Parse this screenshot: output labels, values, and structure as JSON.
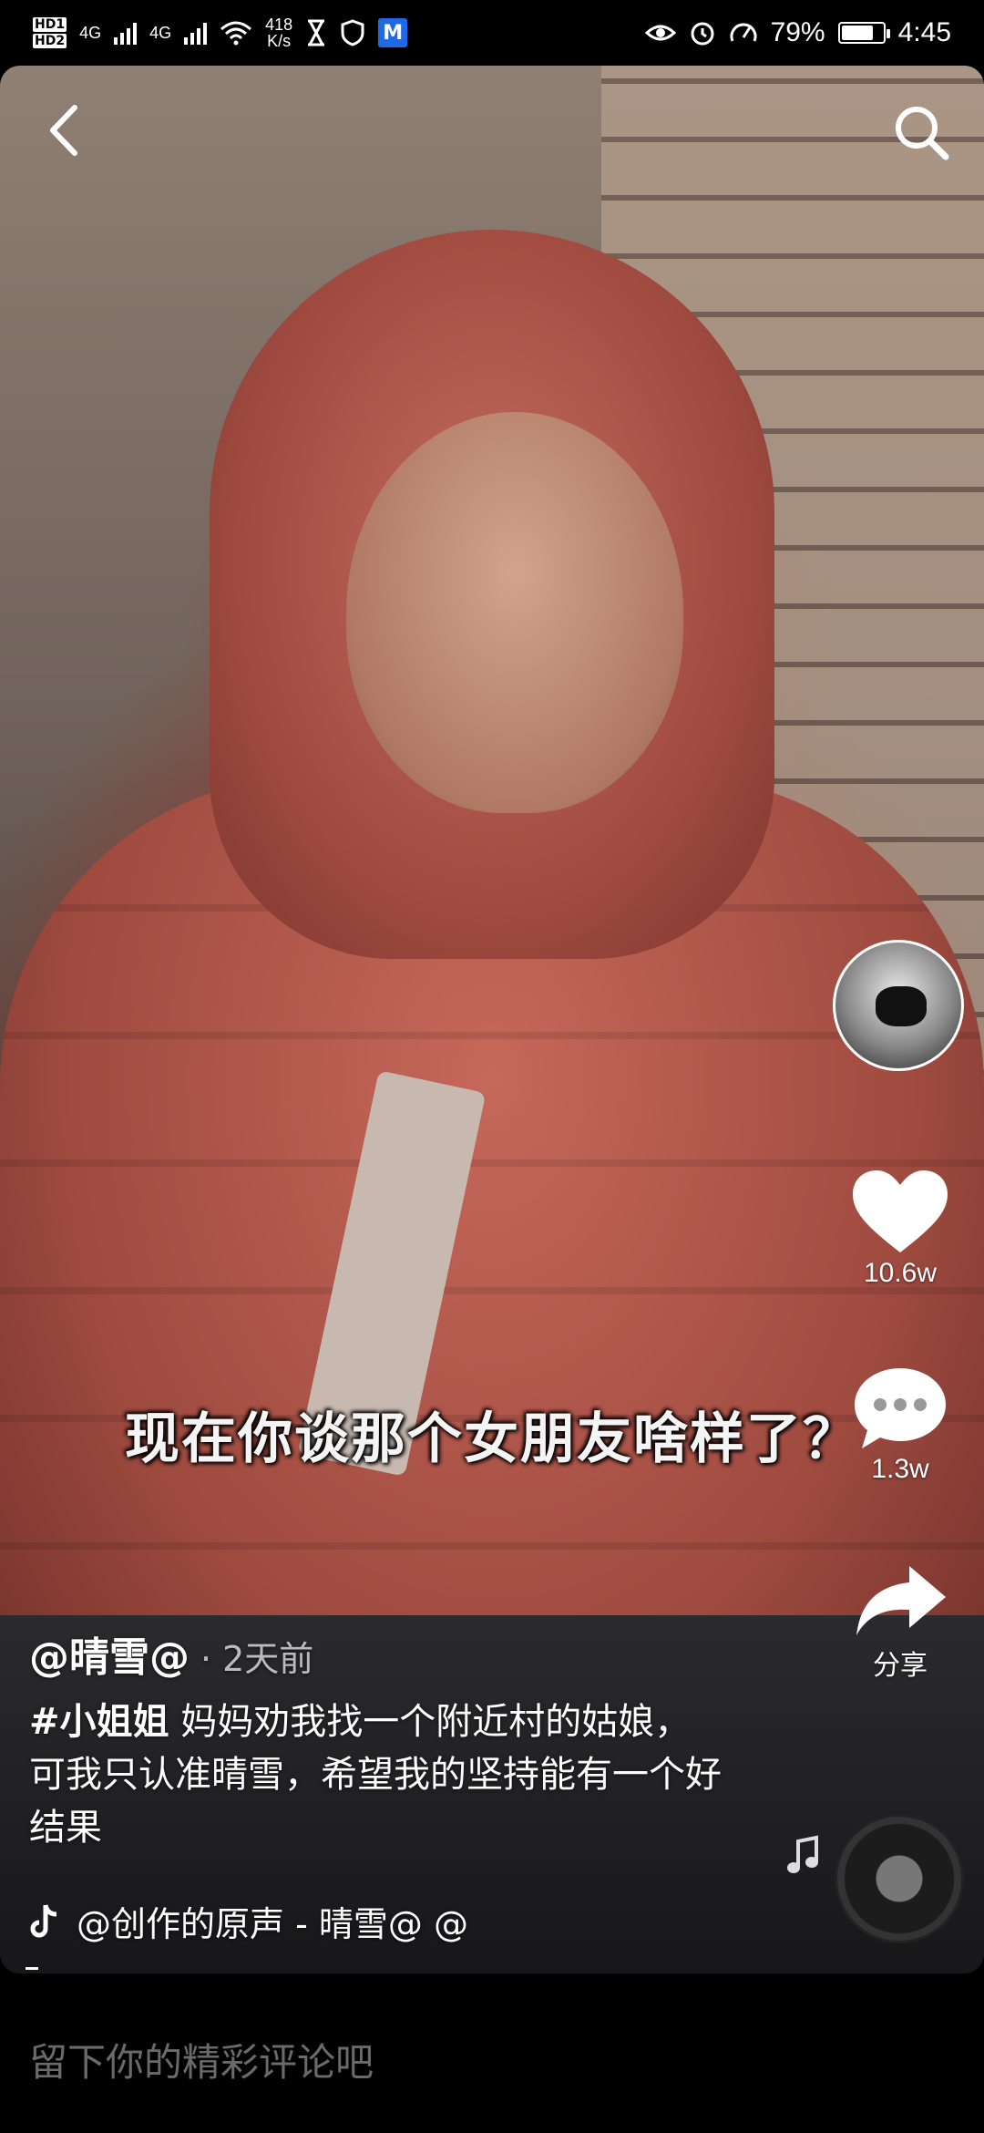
{
  "status_bar": {
    "hd1": "HD1",
    "hd2": "HD2",
    "net1": "4G",
    "net2": "4G",
    "speed_value": "418",
    "speed_unit": "K/s",
    "battery_percent": "79%",
    "battery_level": 0.79,
    "time": "4:45"
  },
  "video": {
    "subtitle": "现在你谈那个女朋友啥样了？"
  },
  "actions": {
    "likes": "10.6w",
    "comments": "1.3w",
    "share_label": "分享"
  },
  "post": {
    "author": "@晴雪@",
    "dot": "·",
    "time": "2天前",
    "hashtag": "#小姐姐",
    "caption": "妈妈劝我找一个附近村的姑娘，可我只认准晴雪，希望我的坚持能有一个好结果",
    "music": "@创作的原声 - 晴雪@    @"
  },
  "comment": {
    "placeholder": "留下你的精彩评论吧"
  },
  "icons": {
    "back": "back-arrow-icon",
    "search": "search-icon",
    "like": "heart-icon",
    "comment": "comment-bubble-icon",
    "share": "share-arrow-icon",
    "music": "tiktok-note-icon"
  }
}
